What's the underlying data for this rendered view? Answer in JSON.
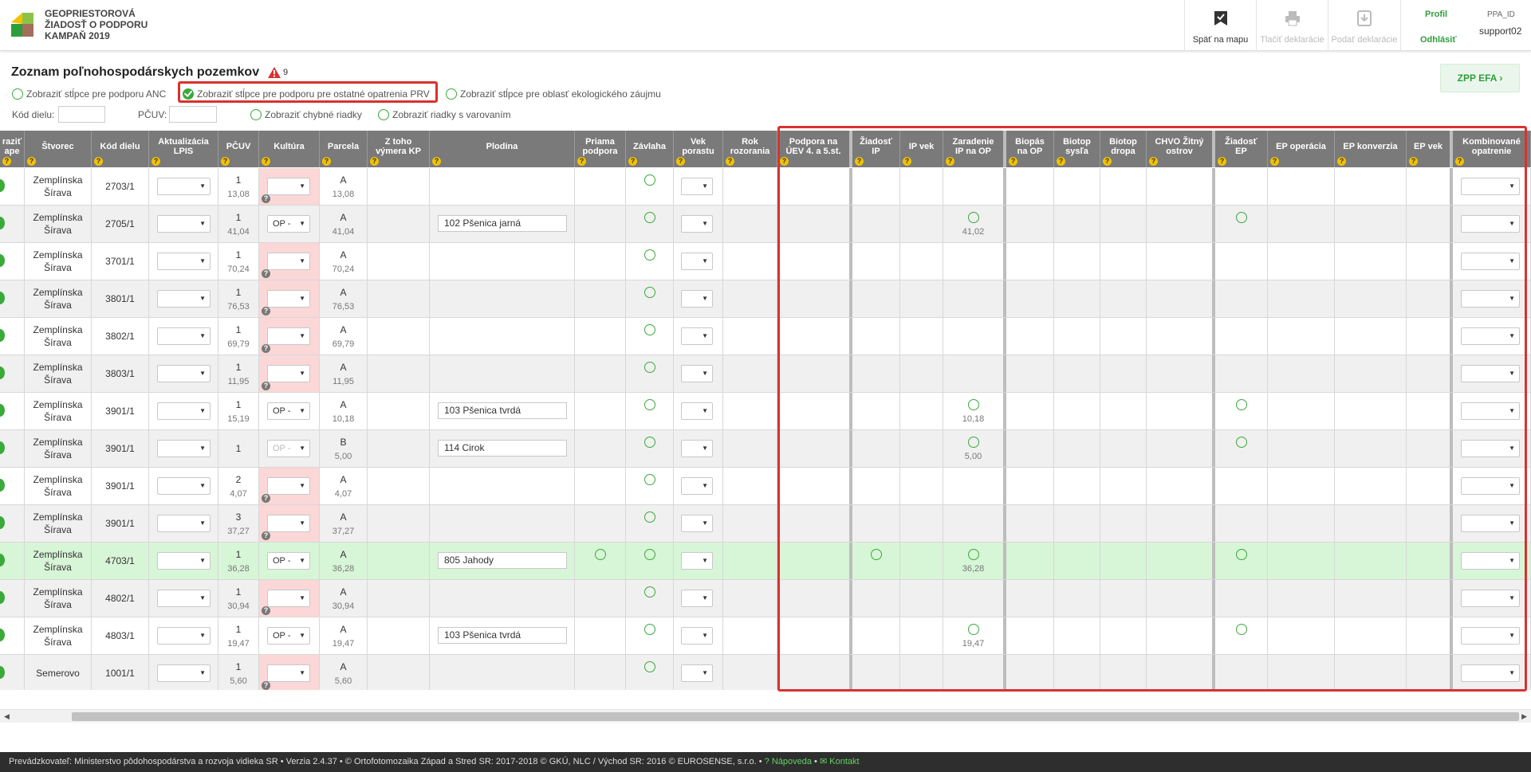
{
  "header": {
    "title_lines": [
      "GEOPRIESTOROVÁ",
      "ŽIADOSŤ O PODPORU",
      "KAMPAŇ 2019"
    ],
    "buttons": [
      {
        "label": "Späť na mapu",
        "icon": "map-check-icon",
        "disabled": false
      },
      {
        "label": "Tlačiť deklarácie",
        "icon": "printer-icon",
        "disabled": true
      },
      {
        "label": "Podať deklarácie",
        "icon": "submit-download-icon",
        "disabled": true
      }
    ],
    "profile": "Profil",
    "logout": "Odhlásiť",
    "ppa_label": "PPA_ID",
    "username": "support02"
  },
  "toolbar": {
    "title": "Zoznam poľnohospodárskych pozemkov",
    "warning_count": "9",
    "zpp_button": "ZPP EFA",
    "options": [
      {
        "label": "Zobraziť stĺpce pre podporu ANC",
        "checked": false
      },
      {
        "label": "Zobraziť stĺpce pre podporu pre ostatné opatrenia PRV",
        "checked": true
      },
      {
        "label": "Zobraziť stĺpce pre oblasť ekologického záujmu",
        "checked": false
      }
    ],
    "filter_kod_label": "Kód dielu:",
    "filter_pcuv_label": "PČUV:",
    "show_errors": "Zobraziť chybné riadky",
    "show_warnings": "Zobraziť riadky s varovaním"
  },
  "columns": {
    "zobrazit": "raziť\nape",
    "stvorec": "Štvorec",
    "kod_dielu": "Kód dielu",
    "aktualizacia": "Aktualizácia\nLPIS",
    "pcuv": "PČUV",
    "kultura": "Kultúra",
    "parcela": "Parcela",
    "z_toho": "Z toho\nvýmera KP",
    "plodina": "Plodina",
    "priama": "Priama\npodpora",
    "zavlaha": "Závlaha",
    "vek_porastu": "Vek\nporastu",
    "rok_rozorania": "Rok\nrozorania",
    "podpora_uev": "Podpora na\nÚEV 4. a 5.st.",
    "ziadost_ip": "Žiadosť\nIP",
    "ip_vek": "IP vek",
    "zaradenie_ip": "Zaradenie\nIP na OP",
    "biopas": "Biopás\nna OP",
    "biotop_sysla": "Biotop\nsysľa",
    "biotop_dropa": "Biotop\ndropa",
    "chvo": "CHVO Žitný\nostrov",
    "ziadost_ep": "Žiadosť\nEP",
    "ep_operacia": "EP operácia",
    "ep_konverzia": "EP konverzia",
    "ep_vek": "EP vek",
    "kombinovane": "Kombinované\nopatrenie"
  },
  "rows": [
    {
      "stvorec": "Zemplínska Šírava",
      "kod": "2703/1",
      "pcuv": "1",
      "pcuv_sub": "13,08",
      "kultura": "",
      "kultura_red": true,
      "parcela": "A",
      "parcela_sub": "13,08",
      "plodina": "",
      "priama": false,
      "zavlaha": true,
      "ziadost_ip": false,
      "zaradenie": false,
      "zaradenie_val": "",
      "ziadost_ep": false,
      "highlight": false
    },
    {
      "stvorec": "Zemplínska Šírava",
      "kod": "2705/1",
      "pcuv": "1",
      "pcuv_sub": "41,04",
      "kultura": "OP -",
      "kultura_red": false,
      "parcela": "A",
      "parcela_sub": "41,04",
      "plodina": "102  Pšenica jarná",
      "priama": false,
      "zavlaha": true,
      "ziadost_ip": false,
      "zaradenie": true,
      "zaradenie_val": "41,02",
      "ziadost_ep": true,
      "highlight": false
    },
    {
      "stvorec": "Zemplínska Šírava",
      "kod": "3701/1",
      "pcuv": "1",
      "pcuv_sub": "70,24",
      "kultura": "",
      "kultura_red": true,
      "parcela": "A",
      "parcela_sub": "70,24",
      "plodina": "",
      "priama": false,
      "zavlaha": true,
      "ziadost_ip": false,
      "zaradenie": false,
      "zaradenie_val": "",
      "ziadost_ep": false,
      "highlight": false
    },
    {
      "stvorec": "Zemplínska Šírava",
      "kod": "3801/1",
      "pcuv": "1",
      "pcuv_sub": "76,53",
      "kultura": "",
      "kultura_red": true,
      "parcela": "A",
      "parcela_sub": "76,53",
      "plodina": "",
      "priama": false,
      "zavlaha": true,
      "ziadost_ip": false,
      "zaradenie": false,
      "zaradenie_val": "",
      "ziadost_ep": false,
      "highlight": false
    },
    {
      "stvorec": "Zemplínska Šírava",
      "kod": "3802/1",
      "pcuv": "1",
      "pcuv_sub": "69,79",
      "kultura": "",
      "kultura_red": true,
      "parcela": "A",
      "parcela_sub": "69,79",
      "plodina": "",
      "priama": false,
      "zavlaha": true,
      "ziadost_ip": false,
      "zaradenie": false,
      "zaradenie_val": "",
      "ziadost_ep": false,
      "highlight": false
    },
    {
      "stvorec": "Zemplínska Šírava",
      "kod": "3803/1",
      "pcuv": "1",
      "pcuv_sub": "11,95",
      "kultura": "",
      "kultura_red": true,
      "parcela": "A",
      "parcela_sub": "11,95",
      "plodina": "",
      "priama": false,
      "zavlaha": true,
      "ziadost_ip": false,
      "zaradenie": false,
      "zaradenie_val": "",
      "ziadost_ep": false,
      "highlight": false
    },
    {
      "stvorec": "Zemplínska Šírava",
      "kod": "3901/1",
      "pcuv": "1",
      "pcuv_sub": "15,19",
      "kultura": "OP -",
      "kultura_red": false,
      "parcela": "A",
      "parcela_sub": "10,18",
      "plodina": "103  Pšenica tvrdá",
      "priama": false,
      "zavlaha": true,
      "ziadost_ip": false,
      "zaradenie": true,
      "zaradenie_val": "10,18",
      "ziadost_ep": true,
      "highlight": false
    },
    {
      "stvorec": "Zemplínska Šírava",
      "kod": "3901/1",
      "pcuv": "1",
      "pcuv_sub": "",
      "kultura": "OP -",
      "kultura_red": false,
      "kultura_disabled": true,
      "parcela": "B",
      "parcela_sub": "5,00",
      "plodina": "114  Cirok",
      "priama": false,
      "zavlaha": true,
      "ziadost_ip": false,
      "zaradenie": true,
      "zaradenie_val": "5,00",
      "ziadost_ep": true,
      "highlight": false
    },
    {
      "stvorec": "Zemplínska Šírava",
      "kod": "3901/1",
      "pcuv": "2",
      "pcuv_sub": "4,07",
      "kultura": "",
      "kultura_red": true,
      "parcela": "A",
      "parcela_sub": "4,07",
      "plodina": "",
      "priama": false,
      "zavlaha": true,
      "ziadost_ip": false,
      "zaradenie": false,
      "zaradenie_val": "",
      "ziadost_ep": false,
      "highlight": false
    },
    {
      "stvorec": "Zemplínska Šírava",
      "kod": "3901/1",
      "pcuv": "3",
      "pcuv_sub": "37,27",
      "kultura": "",
      "kultura_red": true,
      "parcela": "A",
      "parcela_sub": "37,27",
      "plodina": "",
      "priama": false,
      "zavlaha": true,
      "ziadost_ip": false,
      "zaradenie": false,
      "zaradenie_val": "",
      "ziadost_ep": false,
      "highlight": false
    },
    {
      "stvorec": "Zemplínska Šírava",
      "kod": "4703/1",
      "pcuv": "1",
      "pcuv_sub": "36,28",
      "kultura": "OP -",
      "kultura_red": false,
      "parcela": "A",
      "parcela_sub": "36,28",
      "plodina": "805  Jahody",
      "priama": true,
      "zavlaha": true,
      "ziadost_ip": true,
      "zaradenie": true,
      "zaradenie_val": "36,28",
      "ziadost_ep": true,
      "highlight": true
    },
    {
      "stvorec": "Zemplínska Šírava",
      "kod": "4802/1",
      "pcuv": "1",
      "pcuv_sub": "30,94",
      "kultura": "",
      "kultura_red": true,
      "parcela": "A",
      "parcela_sub": "30,94",
      "plodina": "",
      "priama": false,
      "zavlaha": true,
      "ziadost_ip": false,
      "zaradenie": false,
      "zaradenie_val": "",
      "ziadost_ep": false,
      "highlight": false
    },
    {
      "stvorec": "Zemplínska Šírava",
      "kod": "4803/1",
      "pcuv": "1",
      "pcuv_sub": "19,47",
      "kultura": "OP -",
      "kultura_red": false,
      "parcela": "A",
      "parcela_sub": "19,47",
      "plodina": "103  Pšenica tvrdá",
      "priama": false,
      "zavlaha": true,
      "ziadost_ip": false,
      "zaradenie": true,
      "zaradenie_val": "19,47",
      "ziadost_ep": true,
      "highlight": false
    },
    {
      "stvorec": "Semerovo",
      "kod": "1001/1",
      "pcuv": "1",
      "pcuv_sub": "5,60",
      "kultura": "",
      "kultura_red": true,
      "parcela": "A",
      "parcela_sub": "5,60",
      "plodina": "",
      "priama": false,
      "zavlaha": true,
      "ziadost_ip": false,
      "zaradenie": false,
      "zaradenie_val": "",
      "ziadost_ep": false,
      "highlight": false
    }
  ],
  "footer": {
    "text": "Prevádzkovateľ: Ministerstvo pôdohospodárstva a rozvoja vidieka SR • Verzia 2.4.37 • © Ortofotomozaika Západ a Stred SR: 2017-2018 © GKÚ, NLC / Východ SR: 2016 © EUROSENSE, s.r.o. •",
    "help": "Nápoveda",
    "contact": "Kontakt"
  },
  "colors": {
    "accent": "#2e9e3a",
    "highlight_box": "#d9322f",
    "header_bg": "#7a7a7a",
    "warning_red_cell": "#fbd7d7",
    "selected_row": "#d7f5d7"
  }
}
